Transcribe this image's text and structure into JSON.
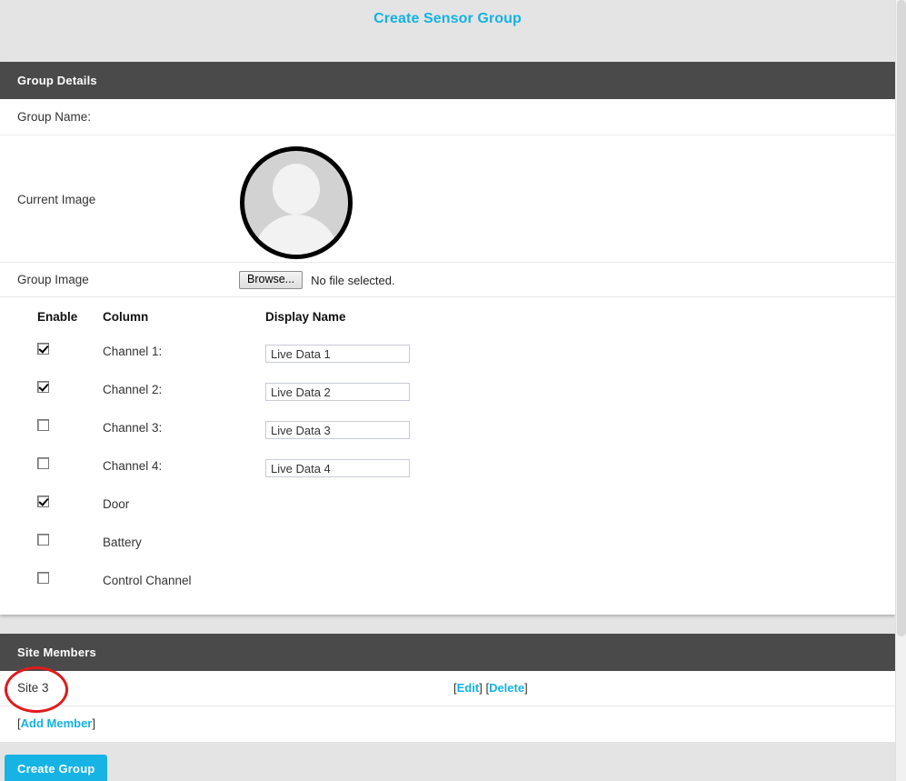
{
  "page": {
    "title": "Create Sensor Group",
    "accent_color": "#14b2e2",
    "panel_header_color": "#4a4a4a",
    "background_color": "#e4e4e4",
    "annotation_color": "#e01b1b"
  },
  "group_details": {
    "header": "Group Details",
    "group_name_label": "Group Name:",
    "group_name_value": "",
    "group_name_placeholder": "",
    "current_image_label": "Current Image",
    "avatar_icon": "user-avatar-placeholder-icon",
    "group_image_label": "Group Image",
    "browse_button": "Browse...",
    "file_status": "No file selected.",
    "table": {
      "headers": {
        "enable": "Enable",
        "column": "Column",
        "display_name": "Display Name"
      },
      "rows": [
        {
          "column": "Channel 1:",
          "enabled": true,
          "display_name": "Live Data 1",
          "has_input": true
        },
        {
          "column": "Channel 2:",
          "enabled": true,
          "display_name": "Live Data 2",
          "has_input": true
        },
        {
          "column": "Channel 3:",
          "enabled": false,
          "display_name": "Live Data 3",
          "has_input": true
        },
        {
          "column": "Channel 4:",
          "enabled": false,
          "display_name": "Live Data 4",
          "has_input": true
        },
        {
          "column": "Door",
          "enabled": true,
          "display_name": "",
          "has_input": false
        },
        {
          "column": "Battery",
          "enabled": false,
          "display_name": "",
          "has_input": false
        },
        {
          "column": "Control Channel",
          "enabled": false,
          "display_name": "",
          "has_input": false
        }
      ]
    }
  },
  "site_members": {
    "header": "Site Members",
    "members": [
      {
        "name": "Site 3",
        "edit_label": "Edit",
        "delete_label": "Delete",
        "bracket_open": "[",
        "bracket_close": "]",
        "highlighted": true
      }
    ],
    "add_member_label": "Add Member",
    "add_member_bracket_open": "[",
    "add_member_bracket_close": "]"
  },
  "footer": {
    "create_group_label": "Create Group"
  }
}
